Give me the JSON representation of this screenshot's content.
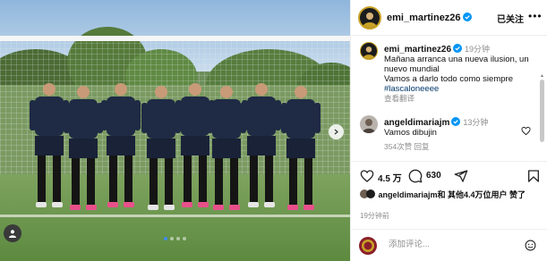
{
  "post": {
    "username": "emi_martinez26",
    "follow_status": "已关注",
    "more_label": "•••"
  },
  "caption": {
    "username": "emi_martinez26",
    "time": "19分钟",
    "line1": "Mañana arranca una nueva ilusion, un nuevo mundial",
    "line2": "Vamos a darlo todo como siempre",
    "hashtag": "#lascaloneeee",
    "translate": "查看翻译"
  },
  "comment": {
    "username": "angeldimariajm",
    "time": "13分钟",
    "text": "Vamos dibujin",
    "meta": "354次赞    回复"
  },
  "actions": {
    "like_count": "4.5 万",
    "comment_count": "630"
  },
  "likes": {
    "text": "angeldimariajm和 其他4.4万位用户 赞了"
  },
  "post_time": "19分钟前",
  "comment_box": {
    "placeholder": "添加评论..."
  },
  "colors": {
    "verified": "#0095f6",
    "hashtag": "#00376b",
    "carousel_dot_active": "#3d8cf0"
  },
  "icons": [
    "verified-badge-icon",
    "heart-icon",
    "comment-icon",
    "share-icon",
    "bookmark-icon",
    "emoji-icon",
    "user-tag-icon",
    "chevron-right-icon",
    "more-icon"
  ],
  "carousel": {
    "slides": 4,
    "active_index": 0
  }
}
